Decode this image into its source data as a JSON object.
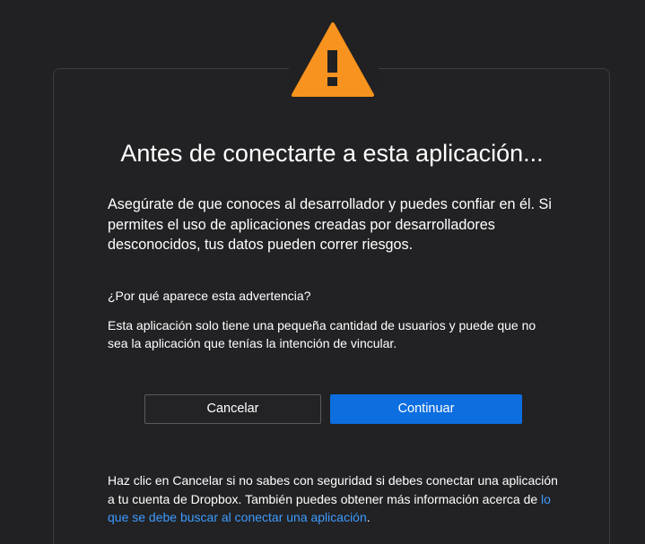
{
  "dialog": {
    "title": "Antes de conectarte a esta aplicación...",
    "intro": "Asegúrate de que conoces al desarrollador y puedes confiar en él. Si permites el uso de aplicaciones creadas por desarrolladores desconocidos, tus datos pueden correr riesgos.",
    "question": "¿Por qué aparece esta advertencia?",
    "explanation": "Esta aplicación solo tiene una pequeña cantidad de usuarios y puede que no sea la aplicación que tenías la intención de vincular.",
    "cancel_label": "Cancelar",
    "continue_label": "Continuar",
    "footer_text": "Haz clic en Cancelar si no sabes con seguridad si debes conectar una aplicación a tu cuenta de Dropbox. También puedes obtener más información acerca de ",
    "footer_link": "lo que se debe buscar al conectar una aplicación",
    "footer_end": "."
  },
  "icons": {
    "warning": "warning-triangle-icon"
  },
  "colors": {
    "background": "#212123",
    "warning": "#f7931e",
    "primary_button": "#0d6ee0",
    "link": "#3d9bff"
  }
}
